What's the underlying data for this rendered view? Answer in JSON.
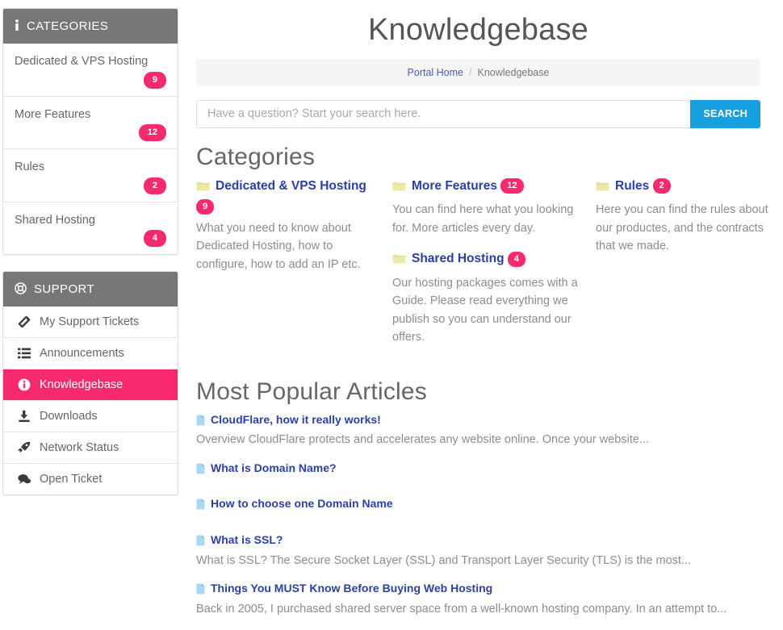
{
  "header": {
    "title": "Knowledgebase",
    "breadcrumb": {
      "home": "Portal Home",
      "separator": "/",
      "current": "Knowledgebase"
    }
  },
  "search": {
    "placeholder": "Have a question? Start your search here.",
    "value": "",
    "button_label": "SEARCH"
  },
  "sidebar": {
    "categories_panel": {
      "title": "CATEGORIES",
      "icon": "info-icon",
      "items": [
        {
          "label": "Dedicated & VPS Hosting",
          "count": "9"
        },
        {
          "label": "More Features",
          "count": "12"
        },
        {
          "label": "Rules",
          "count": "2"
        },
        {
          "label": "Shared Hosting",
          "count": "4"
        }
      ]
    },
    "support_panel": {
      "title": "SUPPORT",
      "icon": "lifering-icon",
      "items": [
        {
          "label": "My Support Tickets",
          "icon": "ticket-icon",
          "active": false
        },
        {
          "label": "Announcements",
          "icon": "list-icon",
          "active": false
        },
        {
          "label": "Knowledgebase",
          "icon": "info-circle-icon",
          "active": true
        },
        {
          "label": "Downloads",
          "icon": "download-icon",
          "active": false
        },
        {
          "label": "Network Status",
          "icon": "rocket-icon",
          "active": false
        },
        {
          "label": "Open Ticket",
          "icon": "comment-icon",
          "active": false
        }
      ]
    }
  },
  "main": {
    "categories_heading": "Categories",
    "categories": [
      {
        "title": "Dedicated & VPS Hosting",
        "count": "9",
        "description": "What you need to know about Dedicated Hosting, how to configure, how to add an IP etc."
      },
      {
        "title": "More Features",
        "count": "12",
        "description": "You can find here what you looking for. More articles every day."
      },
      {
        "title": "Shared Hosting",
        "count": "4",
        "description": "Our hosting packages comes with a Guide. Please read everything we publish so you can understand our offers."
      },
      {
        "title": "Rules",
        "count": "2",
        "description": "Here you can find the rules about our productes, and the contracts that we made."
      }
    ],
    "articles_heading": "Most Popular Articles",
    "articles": [
      {
        "title": "CloudFlare, how it really works!",
        "snippet": "Overview CloudFlare protects and accelerates any website online. Once your website..."
      },
      {
        "title": "What is Domain Name?",
        "snippet": ""
      },
      {
        "title": "How to choose one Domain Name",
        "snippet": ""
      },
      {
        "title": "What is SSL?",
        "snippet": "What is SSL? The Secure Socket Layer (SSL) and Transport Layer Security (TLS) is the most..."
      },
      {
        "title": "Things You MUST Know Before Buying Web Hosting",
        "snippet": "Back in 2005, I purchased shared server space from a well-known hosting company. In an attempt to..."
      }
    ]
  },
  "colors": {
    "accent_pink": "#f72a6d",
    "panel_header_gray": "#777777",
    "link_blue": "#2b3fa5",
    "search_button_blue": "#16a0e0",
    "folder_icon": "#ede9a6",
    "doc_icon": "#a9d8f2"
  }
}
